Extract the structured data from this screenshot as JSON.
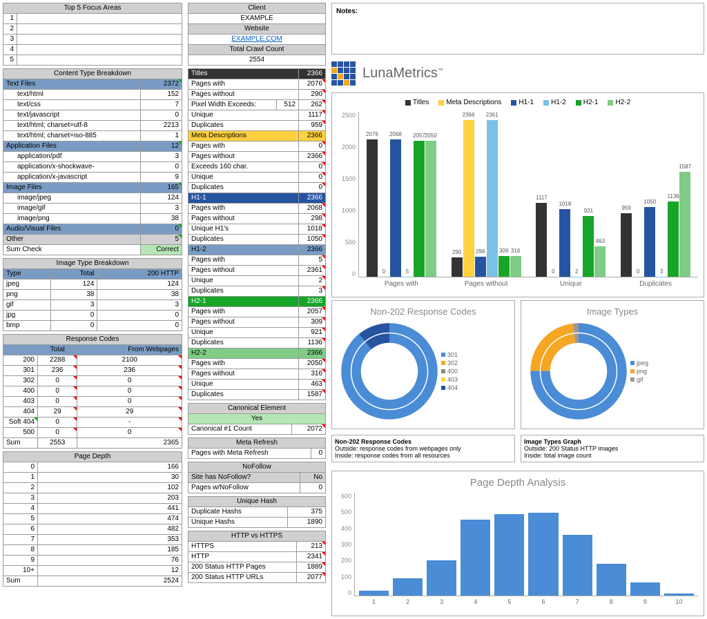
{
  "notes_label": "Notes:",
  "logo_text": "LunaMetrics",
  "focus_areas": {
    "header": "Top 5 Focus Areas",
    "rows": [
      "1",
      "2",
      "3",
      "4",
      "5"
    ]
  },
  "client": {
    "header": "Client",
    "name": "EXAMPLE",
    "website_label": "Website",
    "website": "EXAMPLE.COM",
    "crawl_label": "Total Crawl Count",
    "crawl": "2554"
  },
  "content_type": {
    "header": "Content Type Breakdown",
    "text_files": {
      "label": "Text Files",
      "count": "2372",
      "items": [
        {
          "label": "text/html",
          "count": "152"
        },
        {
          "label": "text/css",
          "count": "7"
        },
        {
          "label": "text/javascript",
          "count": "0"
        },
        {
          "label": "text/html; charset=utf-8",
          "count": "2213"
        },
        {
          "label": "text/html; charset=iso-885",
          "count": "1"
        }
      ]
    },
    "app_files": {
      "label": "Application Files",
      "count": "12",
      "items": [
        {
          "label": "application/pdf",
          "count": "3"
        },
        {
          "label": "application/x-shockwave-",
          "count": "0"
        },
        {
          "label": "application/x-javascript",
          "count": "9"
        }
      ]
    },
    "image_files": {
      "label": "Image Files",
      "count": "165",
      "items": [
        {
          "label": "image/jpeg",
          "count": "124"
        },
        {
          "label": "image/gif",
          "count": "3"
        },
        {
          "label": "image/png",
          "count": "38"
        }
      ]
    },
    "audio_files": {
      "label": "Audio/Visual Files",
      "count": "0"
    },
    "other": {
      "label": "Other",
      "count": "5"
    },
    "sum_check": {
      "label": "Sum Check",
      "value": "Correct"
    }
  },
  "image_type": {
    "header": "Image Type Breakdown",
    "cols": [
      "Type",
      "Total",
      "200 HTTP"
    ],
    "rows": [
      {
        "type": "jpeg",
        "total": "124",
        "http": "124"
      },
      {
        "type": "png",
        "total": "38",
        "http": "38"
      },
      {
        "type": "gif",
        "total": "3",
        "http": "3"
      },
      {
        "type": "jpg",
        "total": "0",
        "http": "0"
      },
      {
        "type": "bmp",
        "total": "0",
        "http": "0"
      }
    ]
  },
  "response_codes": {
    "header": "Response Codes",
    "cols": [
      "",
      "Total",
      "From Webpages"
    ],
    "rows": [
      {
        "code": "200",
        "total": "2288",
        "web": "2100"
      },
      {
        "code": "301",
        "total": "236",
        "web": "236"
      },
      {
        "code": "302",
        "total": "0",
        "web": "0"
      },
      {
        "code": "400",
        "total": "0",
        "web": "0"
      },
      {
        "code": "403",
        "total": "0",
        "web": "0"
      },
      {
        "code": "404",
        "total": "29",
        "web": "29"
      },
      {
        "code": "Soft 404",
        "total": "0",
        "web": "-"
      },
      {
        "code": "500",
        "total": "0",
        "web": "0"
      }
    ],
    "sum": {
      "label": "Sum",
      "total": "2553",
      "web": "2365"
    }
  },
  "page_depth": {
    "header": "Page Depth",
    "rows": [
      {
        "d": "0",
        "c": "166"
      },
      {
        "d": "1",
        "c": "30"
      },
      {
        "d": "2",
        "c": "102"
      },
      {
        "d": "3",
        "c": "203"
      },
      {
        "d": "4",
        "c": "441"
      },
      {
        "d": "5",
        "c": "474"
      },
      {
        "d": "6",
        "c": "482"
      },
      {
        "d": "7",
        "c": "353"
      },
      {
        "d": "8",
        "c": "185"
      },
      {
        "d": "9",
        "c": "76"
      },
      {
        "d": "10+",
        "c": "12"
      }
    ],
    "sum": {
      "label": "Sum",
      "value": "2524"
    }
  },
  "seo": {
    "titles": {
      "label": "Titles",
      "count": "2366",
      "sub": [
        {
          "label": "Pages with",
          "count": "2076"
        },
        {
          "label": "Pages without",
          "count": "290"
        },
        {
          "label": "Pixel Width Exceeds:",
          "extra": "512",
          "count": "262"
        },
        {
          "label": "Unique",
          "count": "1117"
        },
        {
          "label": "Duplicates",
          "count": "959"
        }
      ]
    },
    "meta": {
      "label": "Meta Descriptions",
      "count": "2366",
      "sub": [
        {
          "label": "Pages with",
          "count": "0"
        },
        {
          "label": "Pages without",
          "count": "2366"
        },
        {
          "label": "Exceeds 160 char.",
          "count": "0"
        },
        {
          "label": "Unique",
          "count": "0"
        },
        {
          "label": "Duplicates",
          "count": "0"
        }
      ]
    },
    "h11": {
      "label": "H1-1",
      "count": "2366",
      "sub": [
        {
          "label": "Pages with",
          "count": "2068"
        },
        {
          "label": "Pages without",
          "count": "298"
        },
        {
          "label": "Unique H1's",
          "count": "1018"
        },
        {
          "label": "Duplicates",
          "count": "1050"
        }
      ]
    },
    "h12": {
      "label": "H1-2",
      "count": "2366",
      "sub": [
        {
          "label": "Pages with",
          "count": "5"
        },
        {
          "label": "Pages without",
          "count": "2361"
        },
        {
          "label": "Unique",
          "count": "2"
        },
        {
          "label": "Duplicates",
          "count": "3"
        }
      ]
    },
    "h21": {
      "label": "H2-1",
      "count": "2366",
      "sub": [
        {
          "label": "Pages with",
          "count": "2057"
        },
        {
          "label": "Pages without",
          "count": "309"
        },
        {
          "label": "Unique",
          "count": "921"
        },
        {
          "label": "Duplicates",
          "count": "1136"
        }
      ]
    },
    "h22": {
      "label": "H2-2",
      "count": "2366",
      "sub": [
        {
          "label": "Pages with",
          "count": "2050"
        },
        {
          "label": "Pages without",
          "count": "316"
        },
        {
          "label": "Unique",
          "count": "463"
        },
        {
          "label": "Duplicates",
          "count": "1587"
        }
      ]
    }
  },
  "canonical": {
    "header": "Canonical Element",
    "value": "Yes",
    "row": {
      "label": "Canonical #1 Count",
      "count": "2072"
    }
  },
  "meta_refresh": {
    "header": "Meta Refresh",
    "row": {
      "label": "Pages with Meta Refresh",
      "count": "0"
    }
  },
  "nofollow": {
    "header": "NoFollow",
    "rows": [
      {
        "label": "Site has NoFollow?",
        "count": "No"
      },
      {
        "label": "Pages w/NoFollow",
        "count": "0"
      }
    ]
  },
  "unique_hash": {
    "header": "Unique Hash",
    "rows": [
      {
        "label": "Duplicate Hashs",
        "count": "375"
      },
      {
        "label": "Unique Hashs",
        "count": "1890"
      }
    ]
  },
  "https": {
    "header": "HTTP vs HTTPS",
    "rows": [
      {
        "label": "HTTPS",
        "count": "213"
      },
      {
        "label": "HTTP",
        "count": "2341"
      },
      {
        "label": "200 Status HTTP Pages",
        "count": "1889"
      },
      {
        "label": "200 Status HTTP URLs",
        "count": "2077"
      }
    ]
  },
  "chart_data": [
    {
      "type": "bar",
      "title": "",
      "categories": [
        "Pages with",
        "Pages without",
        "Unique",
        "Duplicates"
      ],
      "series": [
        {
          "name": "Titles",
          "color": "#333",
          "values": [
            2076,
            290,
            1117,
            959
          ]
        },
        {
          "name": "Meta Descriptions",
          "color": "#ffd040",
          "values": [
            0,
            2366,
            0,
            0
          ]
        },
        {
          "name": "H1-1",
          "color": "#2654a1",
          "values": [
            2068,
            298,
            1018,
            1050
          ]
        },
        {
          "name": "H1-2",
          "color": "#7ac1e8",
          "values": [
            5,
            2361,
            2,
            3
          ]
        },
        {
          "name": "H2-1",
          "color": "#16a527",
          "values": [
            2057,
            309,
            921,
            1136
          ]
        },
        {
          "name": "H2-2",
          "color": "#7ecc85",
          "values": [
            2050,
            316,
            463,
            1587
          ]
        }
      ],
      "ylim": [
        0,
        2500
      ]
    },
    {
      "type": "pie",
      "title": "Non-202 Response Codes",
      "series": [
        {
          "name": "outside",
          "data": [
            {
              "name": "301",
              "value": 236,
              "color": "#4a8cd6"
            },
            {
              "name": "302",
              "value": 0,
              "color": "#f5a623"
            },
            {
              "name": "400",
              "value": 0,
              "color": "#888"
            },
            {
              "name": "403",
              "value": 0,
              "color": "#ffd040"
            },
            {
              "name": "404",
              "value": 29,
              "color": "#2654a1"
            }
          ]
        },
        {
          "name": "inside",
          "data": [
            {
              "name": "301",
              "value": 236,
              "color": "#4a8cd6"
            },
            {
              "name": "404",
              "value": 29,
              "color": "#2654a1"
            }
          ]
        }
      ],
      "caption": {
        "title": "Non-202 Response Codes",
        "out": "Outside: response codes from webpages only",
        "in": "Inside: response codes from all resources"
      }
    },
    {
      "type": "pie",
      "title": "Image Types",
      "series": [
        {
          "name": "outside",
          "data": [
            {
              "name": "jpeg",
              "value": 124,
              "color": "#4a8cd6"
            },
            {
              "name": "png",
              "value": 38,
              "color": "#f5a623"
            },
            {
              "name": "gif",
              "value": 3,
              "color": "#999"
            }
          ]
        },
        {
          "name": "inside",
          "data": [
            {
              "name": "jpeg",
              "value": 124,
              "color": "#4a8cd6"
            },
            {
              "name": "png",
              "value": 38,
              "color": "#f5a623"
            },
            {
              "name": "gif",
              "value": 3,
              "color": "#999"
            }
          ]
        }
      ],
      "caption": {
        "title": "Image Types Graph",
        "out": "Outside: 200 Status HTTP images",
        "in": "Inside: total image count"
      }
    },
    {
      "type": "bar",
      "title": "Page Depth Analysis",
      "categories": [
        "1",
        "2",
        "3",
        "4",
        "5",
        "6",
        "7",
        "8",
        "9",
        "10"
      ],
      "values": [
        30,
        102,
        203,
        441,
        474,
        482,
        353,
        185,
        76,
        12
      ],
      "ylim": [
        0,
        600
      ],
      "color": "#4a8cd6"
    }
  ]
}
